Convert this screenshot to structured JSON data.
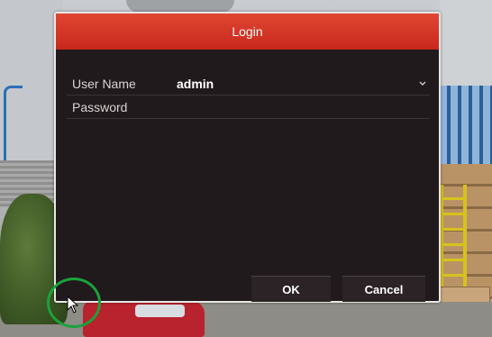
{
  "dialog": {
    "title": "Login"
  },
  "form": {
    "user_name_label": "User Name",
    "user_name_value": "admin",
    "password_label": "Password",
    "password_value": ""
  },
  "buttons": {
    "ok_label": "OK",
    "cancel_label": "Cancel"
  },
  "icons": {
    "dropdown": "chevron-down-icon",
    "pointer": "mouse-pointer-icon"
  },
  "colors": {
    "title_bar": "#d6362a",
    "dialog_body": "#211a1c",
    "highlight_circle": "#1aa23b"
  }
}
